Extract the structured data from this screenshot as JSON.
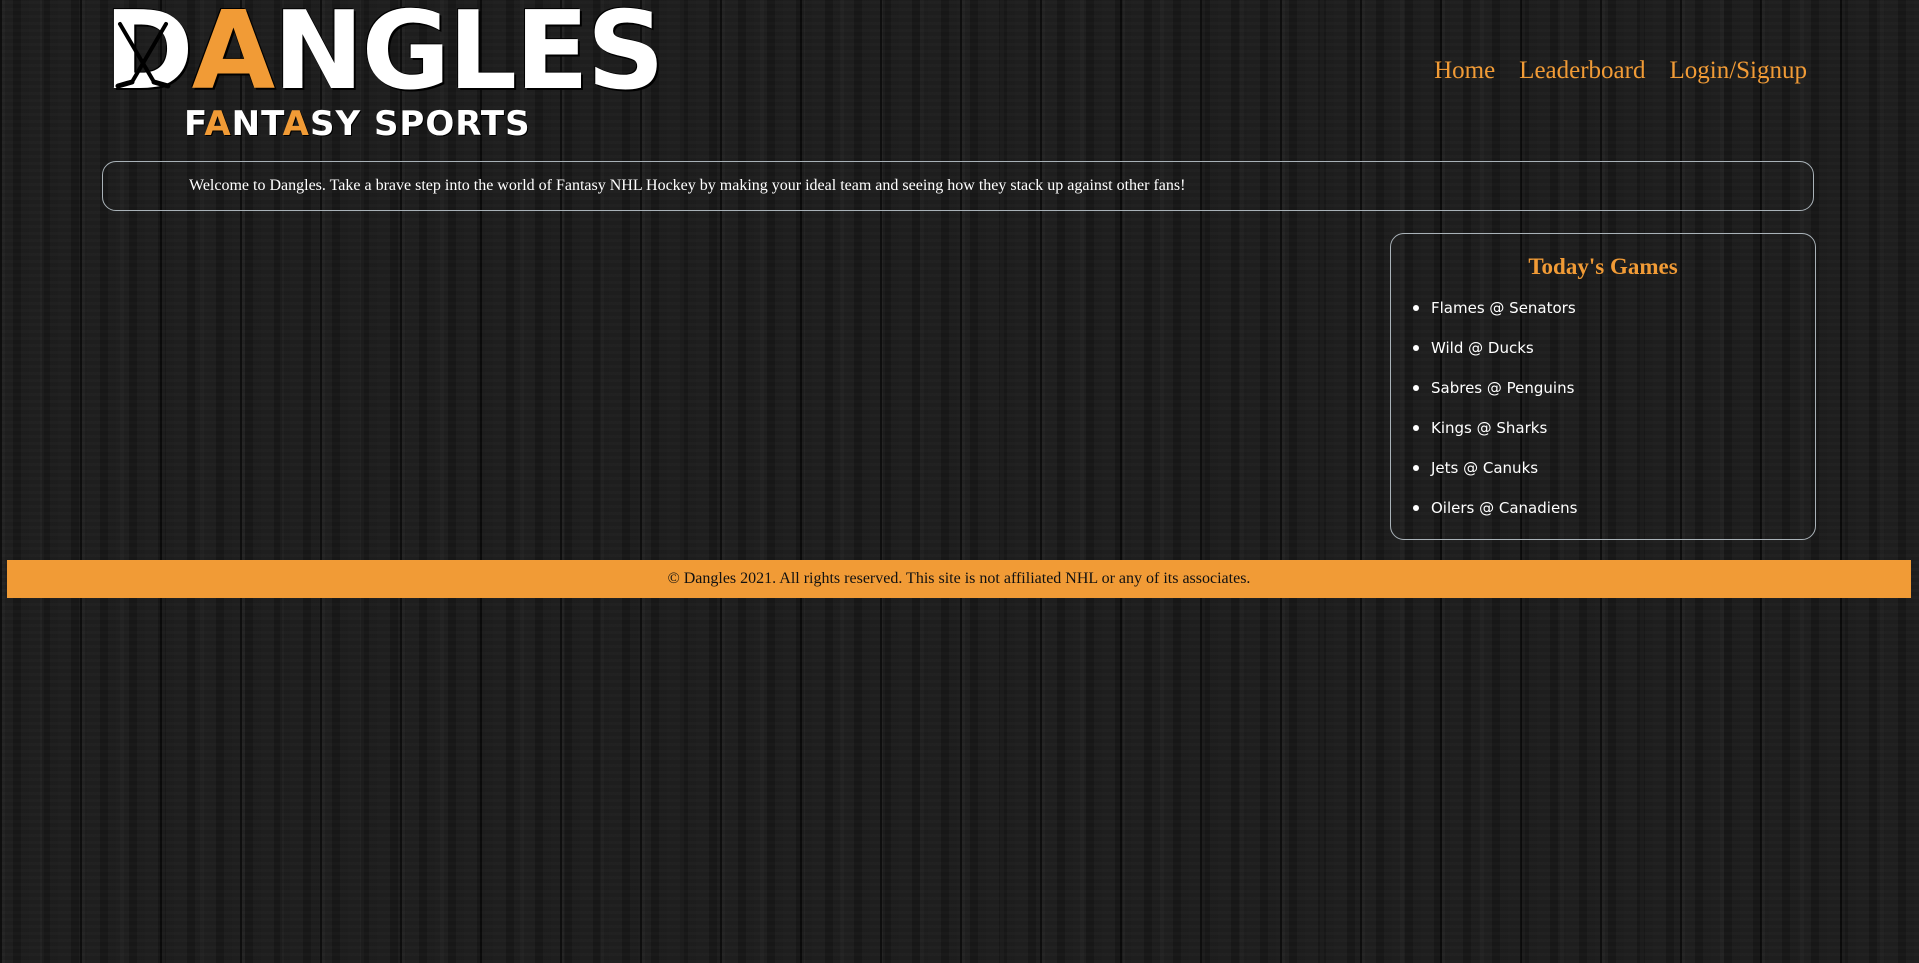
{
  "brand": {
    "logo_main_first": "D",
    "logo_main_accent": "A",
    "logo_main_rest": "NGLES",
    "logo_sub_part1": "F",
    "logo_sub_accent1": "A",
    "logo_sub_part2": "NT",
    "logo_sub_accent2": "A",
    "logo_sub_part3": "SY SPORTS",
    "accent_color": "#f19b36"
  },
  "nav": {
    "items": [
      {
        "label": "Home"
      },
      {
        "label": "Leaderboard"
      },
      {
        "label": "Login/Signup"
      }
    ]
  },
  "welcome": {
    "text": "Welcome to Dangles. Take a brave step into the world of Fantasy NHL Hockey by making your ideal team and seeing how they stack up against other fans!"
  },
  "games": {
    "title": "Today's Games",
    "items": [
      "Flames @ Senators",
      "Wild @ Ducks",
      "Sabres @ Penguins",
      "Kings @ Sharks",
      "Jets @ Canuks",
      "Oilers @ Canadiens"
    ]
  },
  "footer": {
    "text": "© Dangles 2021. All rights reserved. This site is not affiliated NHL or any of its associates."
  }
}
